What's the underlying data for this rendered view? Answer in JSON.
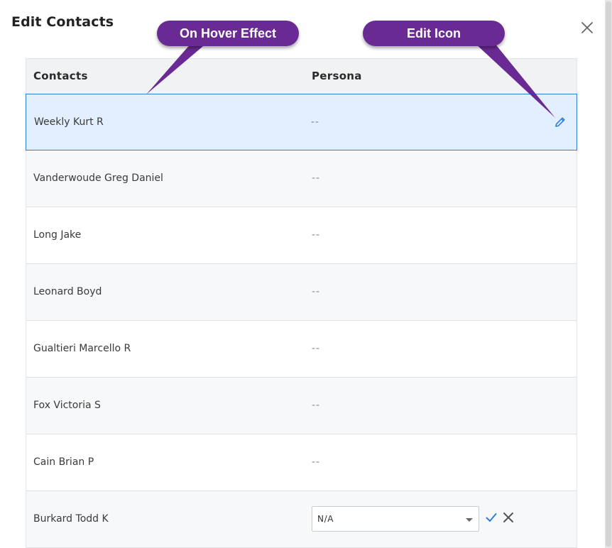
{
  "dialog": {
    "title": "Edit Contacts"
  },
  "icons": {
    "close": "close-icon",
    "edit": "pencil-icon",
    "confirm": "check-icon",
    "cancel": "close-icon"
  },
  "colors": {
    "accent": "#2f7dd6",
    "hover_row": "#e2efff",
    "callout": "#6a2a93"
  },
  "table": {
    "headers": {
      "contacts": "Contacts",
      "persona": "Persona"
    },
    "rows": [
      {
        "name": "Weekly Kurt R",
        "persona": "--"
      },
      {
        "name": "Vanderwoude Greg Daniel",
        "persona": "--"
      },
      {
        "name": "Long Jake",
        "persona": "--"
      },
      {
        "name": "Leonard Boyd",
        "persona": "--"
      },
      {
        "name": "Gualtieri Marcello R",
        "persona": "--"
      },
      {
        "name": "Fox Victoria S",
        "persona": "--"
      },
      {
        "name": "Cain Brian P",
        "persona": "--"
      },
      {
        "name": "Burkard Todd K",
        "persona_select": "N/A"
      }
    ]
  },
  "annotations": {
    "hover": "On Hover Effect",
    "edit": "Edit Icon"
  }
}
